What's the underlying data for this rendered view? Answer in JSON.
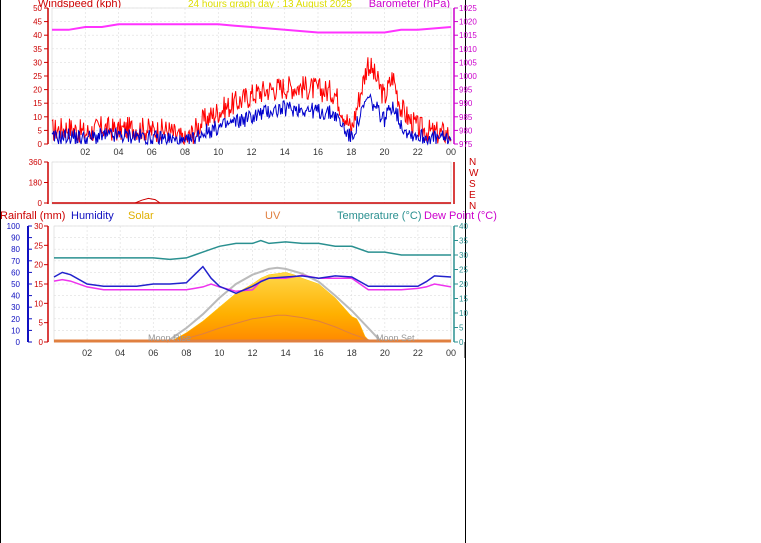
{
  "header": {
    "windspeed_label": "Windspeed (kph)",
    "title": "24 hours graph day : 13 August 2025",
    "barometer_label": "Barometer (hPa)"
  },
  "direction_labels": [
    "N",
    "W",
    "S",
    "E",
    "N"
  ],
  "bottom_labels": {
    "rainfall": "Rainfall (mm)",
    "humidity": "Humidity",
    "solar": "Solar",
    "uv": "UV",
    "temperature": "Temperature (°C)",
    "dewpoint": "Dew Point (°C)"
  },
  "moon": {
    "rise": "Moon Rise",
    "set": "Moon Set"
  },
  "colors": {
    "gust": "#ff0000",
    "wind": "#0000cc",
    "barometer": "#ff33ff",
    "direction": "#cc0000",
    "humidity": "#2222cc",
    "temperature": "#2a9090",
    "dewpoint": "#ee33ee",
    "solar": "#ffc000",
    "uv": "#e08040",
    "rain_axis": "#cc0000",
    "humidity_axis": "#1010c0",
    "temperature_axis": "#2a9090",
    "title": "#dddd00",
    "grid": "#dddddd"
  },
  "chart_data": [
    {
      "type": "line",
      "title": "24 hours graph day : 13 August 2025",
      "xlabel": "",
      "ylabel": "Windspeed (kph)",
      "y2label": "Barometer (hPa)",
      "x_ticks": [
        "02",
        "04",
        "06",
        "08",
        "10",
        "12",
        "14",
        "16",
        "18",
        "20",
        "22",
        "00"
      ],
      "x": [
        0,
        1,
        2,
        3,
        4,
        5,
        6,
        7,
        8,
        9,
        10,
        11,
        12,
        13,
        14,
        15,
        16,
        17,
        18,
        19,
        19.5,
        20,
        20.5,
        21,
        21.5,
        22,
        23,
        24
      ],
      "ylim": [
        0,
        50
      ],
      "y_ticks": [
        0,
        5,
        10,
        15,
        20,
        25,
        30,
        35,
        40,
        45,
        50
      ],
      "y2lim": [
        975,
        1025
      ],
      "y2_ticks": [
        975,
        980,
        985,
        990,
        995,
        1000,
        1005,
        1010,
        1015,
        1020,
        1025
      ],
      "grid": true,
      "series": [
        {
          "name": "",
          "axis": "left",
          "values": [
            5,
            6,
            4,
            6,
            5,
            6,
            5,
            5,
            1,
            8,
            12,
            15,
            18,
            20,
            21,
            21,
            20,
            19,
            5,
            30,
            24,
            17,
            25,
            13,
            9,
            6,
            4,
            4
          ]
        },
        {
          "name": "",
          "axis": "left",
          "values": [
            2,
            3,
            2,
            3,
            3,
            3,
            2,
            2,
            0,
            4,
            6,
            8,
            10,
            12,
            13,
            13,
            12,
            11,
            2,
            17,
            13,
            9,
            15,
            7,
            4,
            3,
            2,
            2
          ]
        },
        {
          "name": "",
          "axis": "right",
          "values": [
            1017,
            1017,
            1018,
            1018,
            1019,
            1019,
            1019,
            1019,
            1019,
            1019,
            1019,
            1018.5,
            1018,
            1017.5,
            1017,
            1016.5,
            1016,
            1016,
            1016,
            1016,
            1016,
            1016,
            1016.5,
            1017,
            1017,
            1017,
            1017.5,
            1018
          ]
        }
      ]
    },
    {
      "type": "line",
      "title": "",
      "ylabel": "",
      "ylim": [
        0,
        360
      ],
      "y_ticks": [
        0,
        180,
        360
      ],
      "x": [
        0,
        5.0,
        5.4,
        5.8,
        6.2,
        6.5,
        24
      ],
      "series": [
        {
          "name": "",
          "values": [
            0,
            0,
            25,
            40,
            30,
            0,
            0
          ]
        }
      ]
    },
    {
      "type": "area",
      "title": "",
      "x_ticks": [
        "02",
        "04",
        "06",
        "08",
        "10",
        "12",
        "14",
        "16",
        "18",
        "20",
        "22",
        "00"
      ],
      "rain_ticks": [
        0,
        5,
        10,
        15,
        20,
        25,
        30
      ],
      "rain_ylim": [
        0,
        30
      ],
      "humidity_ticks": [
        0,
        10,
        20,
        30,
        40,
        50,
        60,
        70,
        80,
        90,
        100
      ],
      "humidity_ylim": [
        0,
        100
      ],
      "temperature_ticks": [
        0,
        5,
        10,
        15,
        20,
        25,
        30,
        35,
        40
      ],
      "temperature_ylim": [
        0,
        40
      ],
      "x": [
        0,
        0.5,
        1,
        2,
        3,
        4,
        5,
        6,
        7,
        8,
        8.5,
        9,
        9.5,
        10,
        11,
        12,
        12.5,
        13,
        14,
        15,
        16,
        17,
        18,
        19,
        20,
        21,
        22,
        22.5,
        23,
        24
      ],
      "series": [
        {
          "name": "Humidity",
          "axis": "humidity",
          "values": [
            56,
            60,
            58,
            50,
            48,
            48,
            48,
            50,
            50,
            51,
            58,
            65,
            55,
            48,
            42,
            48,
            52,
            55,
            56,
            57,
            55,
            57,
            56,
            48,
            48,
            48,
            48,
            52,
            57,
            56
          ]
        },
        {
          "name": "Temperature (°C)",
          "axis": "temperature",
          "values": [
            29,
            29,
            29,
            29,
            29,
            29,
            29,
            29,
            28.5,
            29,
            30,
            31,
            32,
            33,
            34,
            34,
            35,
            34,
            34.5,
            34,
            34,
            33,
            33,
            31,
            31,
            30,
            30,
            30,
            30,
            30
          ]
        },
        {
          "name": "Dew Point (°C)",
          "axis": "temperature",
          "values": [
            21,
            21.5,
            21,
            19,
            18,
            18,
            18,
            18,
            18,
            18,
            18.5,
            19,
            20,
            19,
            17.5,
            18,
            21,
            22,
            22,
            23,
            22,
            22,
            22,
            18,
            18,
            18,
            18.5,
            19,
            20,
            19
          ]
        }
      ],
      "solar_max_curve": {
        "name": "",
        "axis": "humidity",
        "x": [
          6.8,
          8,
          9,
          10,
          11,
          12,
          13,
          13.5,
          14,
          15,
          16,
          17,
          18,
          19,
          19.8
        ],
        "values": [
          0,
          12,
          24,
          38,
          50,
          58,
          63,
          64,
          63,
          59,
          52,
          40,
          27,
          12,
          0
        ]
      },
      "solar": {
        "name": "Solar",
        "axis": "humidity",
        "x": [
          7,
          8,
          9,
          10,
          11,
          12,
          12.5,
          13,
          13.5,
          14,
          14.5,
          15,
          16,
          17,
          18,
          18.3,
          18.5,
          18.8,
          19,
          19.5
        ],
        "values": [
          0,
          8,
          18,
          30,
          42,
          50,
          55,
          58,
          59,
          60,
          58,
          55,
          50,
          38,
          22,
          20,
          15,
          5,
          2,
          0
        ]
      },
      "uv": {
        "name": "UV",
        "axis": "humidity",
        "x": [
          7,
          8,
          9,
          10,
          11,
          12,
          13,
          13.5,
          14,
          15,
          16,
          17,
          18,
          19,
          19.5
        ],
        "values": [
          0,
          3,
          7,
          12,
          16,
          20,
          22,
          23,
          23,
          21,
          18,
          13,
          7,
          2,
          0
        ]
      }
    }
  ]
}
